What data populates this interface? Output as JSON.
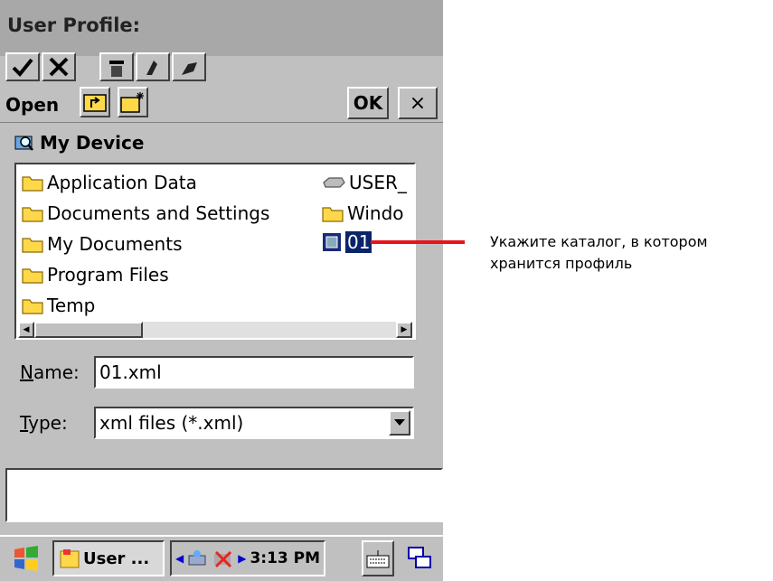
{
  "window": {
    "title": "User Profile:"
  },
  "toolbar": {
    "icons": [
      "checkmark-icon",
      "cross-icon",
      "trash-icon",
      "import-icon",
      "export-icon"
    ]
  },
  "dialog": {
    "title": "Open",
    "ok_label": "OK",
    "close_label": "×",
    "location": "My Device",
    "files": [
      {
        "name": "Application Data",
        "icon": "folder-icon"
      },
      {
        "name": "Documents and Settings",
        "icon": "folder-icon"
      },
      {
        "name": "My Documents",
        "icon": "folder-icon"
      },
      {
        "name": "Program Files",
        "icon": "folder-icon"
      },
      {
        "name": "Temp",
        "icon": "folder-icon"
      },
      {
        "name": "USER_",
        "icon": "drive-icon"
      },
      {
        "name": "Windo",
        "icon": "folder-icon"
      },
      {
        "name": "01",
        "icon": "xml-file-icon",
        "selected": true
      }
    ],
    "name_label_u": "N",
    "name_label_rest": "ame:",
    "name_value": "01.xml",
    "type_label_u": "T",
    "type_label_rest": "ype:",
    "type_value": "xml files (*.xml)"
  },
  "taskbar": {
    "app_label": "User ...",
    "time": "3:13 PM"
  },
  "annotation": {
    "text": "Укажите каталог, в котором хранится профиль",
    "line1": "Укажите каталог, в котором",
    "line2": "хранится профиль",
    "color": "#e8141c"
  }
}
